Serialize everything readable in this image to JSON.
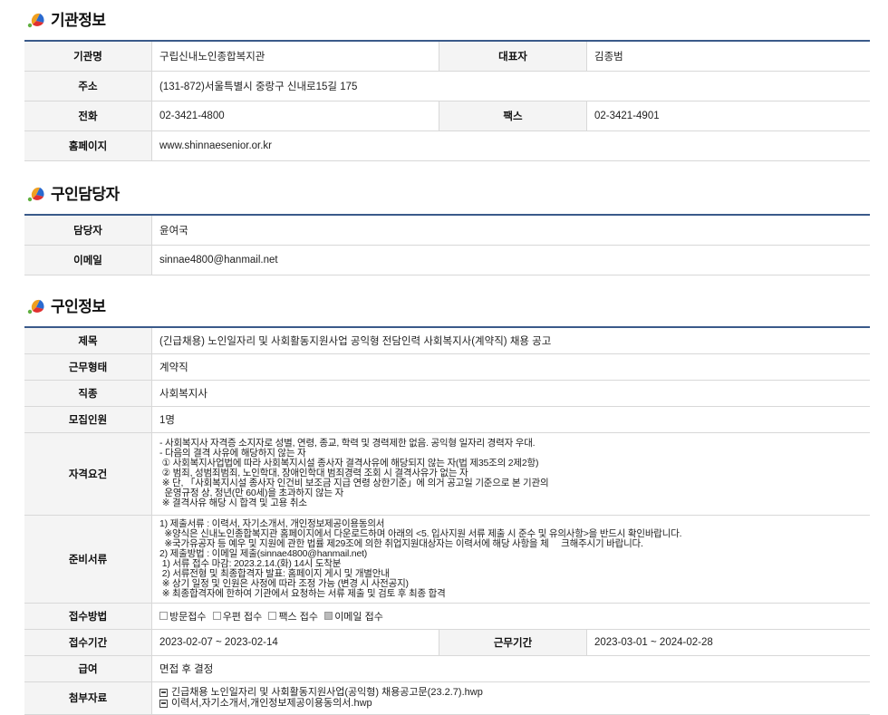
{
  "section_org": {
    "title": "기관정보",
    "rows": {
      "name_label": "기관명",
      "name_value": "구립신내노인종합복지관",
      "rep_label": "대표자",
      "rep_value": "김종범",
      "addr_label": "주소",
      "addr_value": "(131-872)서울특별시 중랑구 신내로15길 175",
      "tel_label": "전화",
      "tel_value": "02-3421-4800",
      "fax_label": "팩스",
      "fax_value": "02-3421-4901",
      "home_label": "홈페이지",
      "home_value": "www.shinnaesenior.or.kr"
    }
  },
  "section_contact": {
    "title": "구인담당자",
    "manager_label": "담당자",
    "manager_value": "윤여국",
    "email_label": "이메일",
    "email_value": "sinnae4800@hanmail.net"
  },
  "section_job": {
    "title": "구인정보",
    "subject_label": "제목",
    "subject_value": "(긴급채용) 노인일자리 및 사회활동지원사업 공익형 전담인력 사회복지사(계약직) 채용 공고",
    "worktype_label": "근무형태",
    "worktype_value": "계약직",
    "jobtype_label": "직종",
    "jobtype_value": "사회복지사",
    "headcount_label": "모집인원",
    "headcount_value": "1명",
    "qual_label": "자격요건",
    "qual_value": "- 사회복지사 자격증 소지자로 성별, 연령, 종교, 학력 및 경력제한 없음. 공익형 일자리 경력자 우대.\n- 다음의 결격 사유에 해당하지 않는 자\n ① 사회복지사업법에 따라 사회복지시설 종사자 결격사유에 해당되지 않는 자(법 제35조의 2제2항)\n ② 범죄, 성범죄범죄, 노인학대, 장애인학대 범죄경력 조회 시 결격사유가 없는 자\n ※ 단, 「사회복지시설 종사자 인건비 보조금 지급 연령 상한기준」에 의거 공고일 기준으로 본 기관의\n  운영규정 상, 정년(만 60세)을 초과하지 않는 자\n ※ 결격사유 해당 시 합격 및 고용 취소",
    "docs_label": "준비서류",
    "docs_value": "1) 제출서류 : 이력서, 자기소개서, 개인정보제공이용동의서\n  ※양식은 신내노인종합복지관 홈페이지에서 다운로드하며 아래의 <5. 입사지원 서류 제출 시 준수 및 유의사항>을 반드시 확인바랍니다.\n  ※국가유공자 등 예우 및 지원에 관한 법률 제29조에 의한 취업지원대상자는 이력서에 해당 사항을 체     크해주시기 바랍니다.\n2) 제출방법 : 이메일 제출(sinnae4800@hanmail.net)\n 1) 서류 접수 마감: 2023.2.14.(화) 14시 도착분\n 2) 서류전형 및 최종합격자 발표: 홈페이지 게시 및 개별안내\n ※ 상기 일정 및 인원은 사정에 따라 조정 가능 (변경 시 사전공지)\n ※ 최종합격자에 한하여 기관에서 요청하는 서류 제출 및 검토 후 최종 합격",
    "method_label": "접수방법",
    "methods": [
      {
        "label": "방문접수",
        "checked": false
      },
      {
        "label": "우편 접수",
        "checked": false
      },
      {
        "label": "팩스 접수",
        "checked": false
      },
      {
        "label": "이메일 접수",
        "checked": true
      }
    ],
    "period_label": "접수기간",
    "period_value": "2023-02-07 ~ 2023-02-14",
    "work_period_label": "근무기간",
    "work_period_value": "2023-03-01 ~ 2024-02-28",
    "salary_label": "급여",
    "salary_value": "면접 후 결정",
    "attach_label": "첨부자료",
    "attachments": [
      "긴급채용 노인일자리 및 사회활동지원사업(공익형) 채용공고문(23.2.7).hwp",
      "이력서,자기소개서,개인정보제공이용동의서.hwp"
    ]
  },
  "colors": {
    "table_top_border": "#3a5a8a",
    "header_bg": "#f4f4f4",
    "logo_orange": "#f0a020",
    "logo_blue": "#2a6ad0",
    "logo_red": "#e03030",
    "logo_green": "#60b040"
  }
}
